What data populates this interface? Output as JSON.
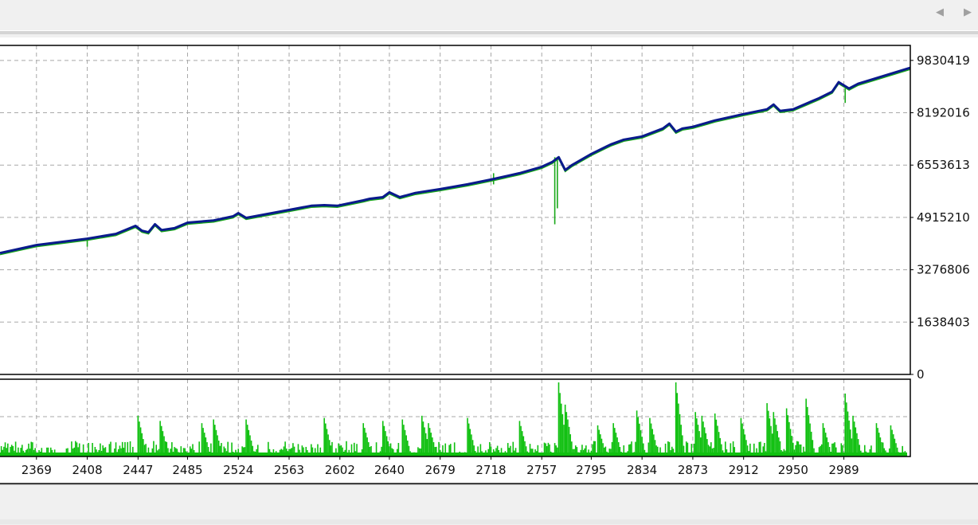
{
  "toolbar": {
    "prev_icon": "◀",
    "next_icon": "▶"
  },
  "colors": {
    "equity_line": "#0a1a8c",
    "balance_line": "#18a818",
    "volume_bars": "#10c010",
    "grid": "#a8a8a8",
    "frame": "#000000"
  },
  "chart_data": [
    {
      "type": "line",
      "xlabel": "",
      "ylabel": "",
      "grid": true,
      "xlim": [
        2341,
        3040
      ],
      "ylim": [
        0,
        10300000
      ],
      "y_ticks": [
        "9830419",
        "8192016",
        "6553613",
        "4915210",
        "3276806",
        "1638403",
        "0"
      ],
      "y_tick_values": [
        9830419,
        8192016,
        6553613,
        4915210,
        3276806,
        1638403,
        0
      ],
      "series": [
        {
          "color": "#0a1a8c",
          "x": [
            2341,
            2369,
            2408,
            2430,
            2445,
            2450,
            2455,
            2460,
            2465,
            2470,
            2475,
            2485,
            2505,
            2520,
            2524,
            2530,
            2563,
            2580,
            2590,
            2600,
            2620,
            2625,
            2635,
            2640,
            2648,
            2660,
            2679,
            2700,
            2718,
            2740,
            2757,
            2765,
            2770,
            2775,
            2780,
            2795,
            2810,
            2820,
            2834,
            2850,
            2855,
            2860,
            2865,
            2873,
            2890,
            2912,
            2930,
            2935,
            2940,
            2950,
            2970,
            2980,
            2985,
            2989,
            2993,
            3000,
            3020,
            3040
          ],
          "values": [
            3800000,
            4050000,
            4250000,
            4400000,
            4650000,
            4500000,
            4450000,
            4700000,
            4520000,
            4550000,
            4580000,
            4750000,
            4820000,
            4950000,
            5050000,
            4900000,
            5150000,
            5280000,
            5300000,
            5280000,
            5450000,
            5500000,
            5550000,
            5700000,
            5550000,
            5680000,
            5800000,
            5950000,
            6100000,
            6300000,
            6500000,
            6650000,
            6800000,
            6400000,
            6550000,
            6900000,
            7200000,
            7350000,
            7450000,
            7700000,
            7850000,
            7600000,
            7700000,
            7750000,
            7950000,
            8150000,
            8300000,
            8450000,
            8250000,
            8300000,
            8650000,
            8850000,
            9150000,
            9050000,
            8950000,
            9100000,
            9350000,
            9600000
          ]
        }
      ]
    },
    {
      "type": "bar",
      "grid": true,
      "x_ticks": [
        "2369",
        "2408",
        "2447",
        "2485",
        "2524",
        "2563",
        "2602",
        "2640",
        "2679",
        "2718",
        "2757",
        "2795",
        "2834",
        "2873",
        "2912",
        "2950",
        "2989"
      ],
      "x_tick_values": [
        2369,
        2408,
        2447,
        2485,
        2524,
        2563,
        2602,
        2640,
        2679,
        2718,
        2757,
        2795,
        2834,
        2873,
        2912,
        2950,
        2989
      ],
      "peaks": {
        "x": [
          2447,
          2464,
          2496,
          2505,
          2530,
          2590,
          2620,
          2635,
          2650,
          2665,
          2670,
          2700,
          2740,
          2770,
          2775,
          2800,
          2812,
          2830,
          2840,
          2860,
          2875,
          2880,
          2890,
          2910,
          2930,
          2935,
          2945,
          2960,
          2973,
          2990,
          2996,
          3014,
          3025
        ],
        "values": [
          0.55,
          0.48,
          0.45,
          0.5,
          0.5,
          0.52,
          0.45,
          0.48,
          0.5,
          0.55,
          0.45,
          0.52,
          0.48,
          1.0,
          0.7,
          0.42,
          0.45,
          0.62,
          0.52,
          1.0,
          0.6,
          0.55,
          0.58,
          0.52,
          0.72,
          0.6,
          0.65,
          0.78,
          0.45,
          0.85,
          0.55,
          0.45,
          0.42
        ]
      },
      "ylim": [
        0,
        1.0
      ]
    }
  ]
}
